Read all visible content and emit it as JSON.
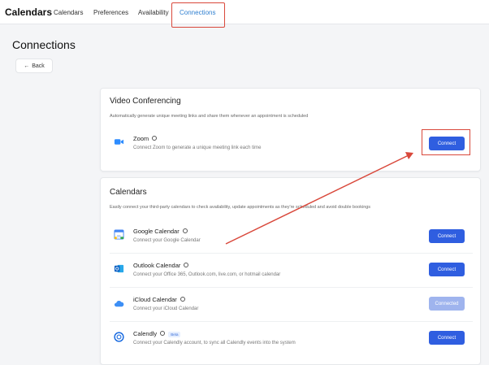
{
  "nav": {
    "brand": "Calendars",
    "links": [
      "Calendars",
      "Preferences",
      "Availability",
      "Connections"
    ]
  },
  "page": {
    "title": "Connections",
    "back_label": "Back"
  },
  "video": {
    "title": "Video Conferencing",
    "description": "Automatically generate unique meeting links and share them whenever an appointment is scheduled",
    "items": [
      {
        "name": "Zoom",
        "description": "Connect Zoom to generate a unique meeting link each time",
        "button": "Connect"
      }
    ]
  },
  "calendars": {
    "title": "Calendars",
    "description": "Easily connect your third-party calendars to check availability, update appointments as they're scheduled and avoid double bookings",
    "items": [
      {
        "name": "Google Calendar",
        "description": "Connect your Google Calendar",
        "button": "Connect"
      },
      {
        "name": "Outlook Calendar",
        "description": "Connect your Office 365, Outlook.com, live.com, or hotmail calendar",
        "button": "Connect"
      },
      {
        "name": "iCloud Calendar",
        "description": "Connect your iCloud Calendar",
        "button": "Connected"
      },
      {
        "name": "Calendly",
        "badge": "Beta",
        "description": "Connect your Calendly account, to sync all Calendly events into the system",
        "button": "Connect"
      }
    ]
  },
  "colors": {
    "accent": "#2f5ee0",
    "annotation": "#d9483b"
  }
}
